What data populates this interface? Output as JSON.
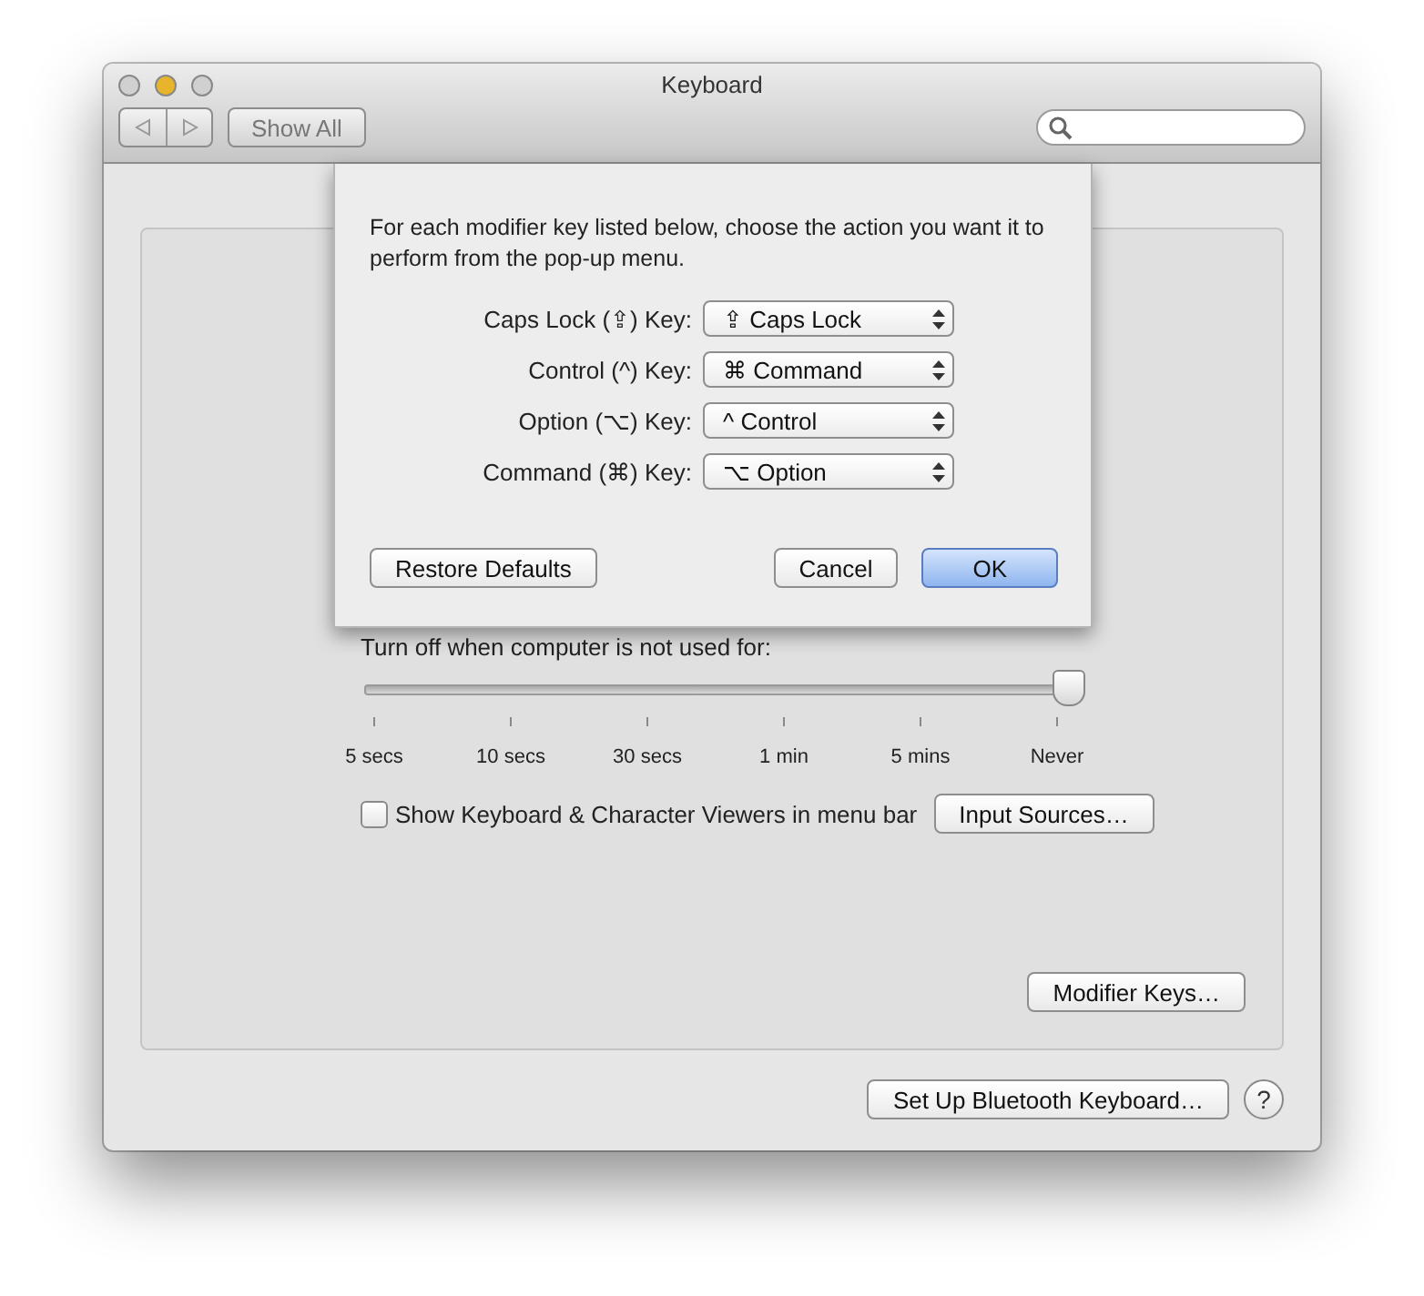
{
  "window": {
    "title": "Keyboard"
  },
  "toolbar": {
    "show_all": "Show All"
  },
  "sheet": {
    "instructions": "For each modifier key listed below, choose the action you want it to perform from the pop-up menu.",
    "rows": [
      {
        "label": "Caps Lock (⇪) Key:",
        "value": "⇪ Caps Lock"
      },
      {
        "label": "Control (^) Key:",
        "value": "⌘ Command"
      },
      {
        "label": "Option (⌥) Key:",
        "value": "^ Control"
      },
      {
        "label": "Command (⌘) Key:",
        "value": "⌥ Option"
      }
    ],
    "buttons": [
      {
        "label": "Restore Defaults",
        "kind": "secondary"
      },
      {
        "label": "Cancel",
        "kind": "secondary"
      },
      {
        "label": "OK",
        "kind": "default"
      }
    ]
  },
  "backlight": {
    "label": "Turn off when computer is not used for:",
    "level": 1,
    "ticks": [
      "5 secs",
      "10 secs",
      "30 secs",
      "1 min",
      "5 mins",
      "Never"
    ]
  },
  "viewer_checkbox": {
    "label": "Show Keyboard & Character Viewers in menu bar",
    "checked": false
  },
  "input_sources_button": "Input Sources…",
  "modifier_keys_button": "Modifier Keys…",
  "bluetooth_button": "Set Up Bluetooth Keyboard…",
  "help_button": "?"
}
